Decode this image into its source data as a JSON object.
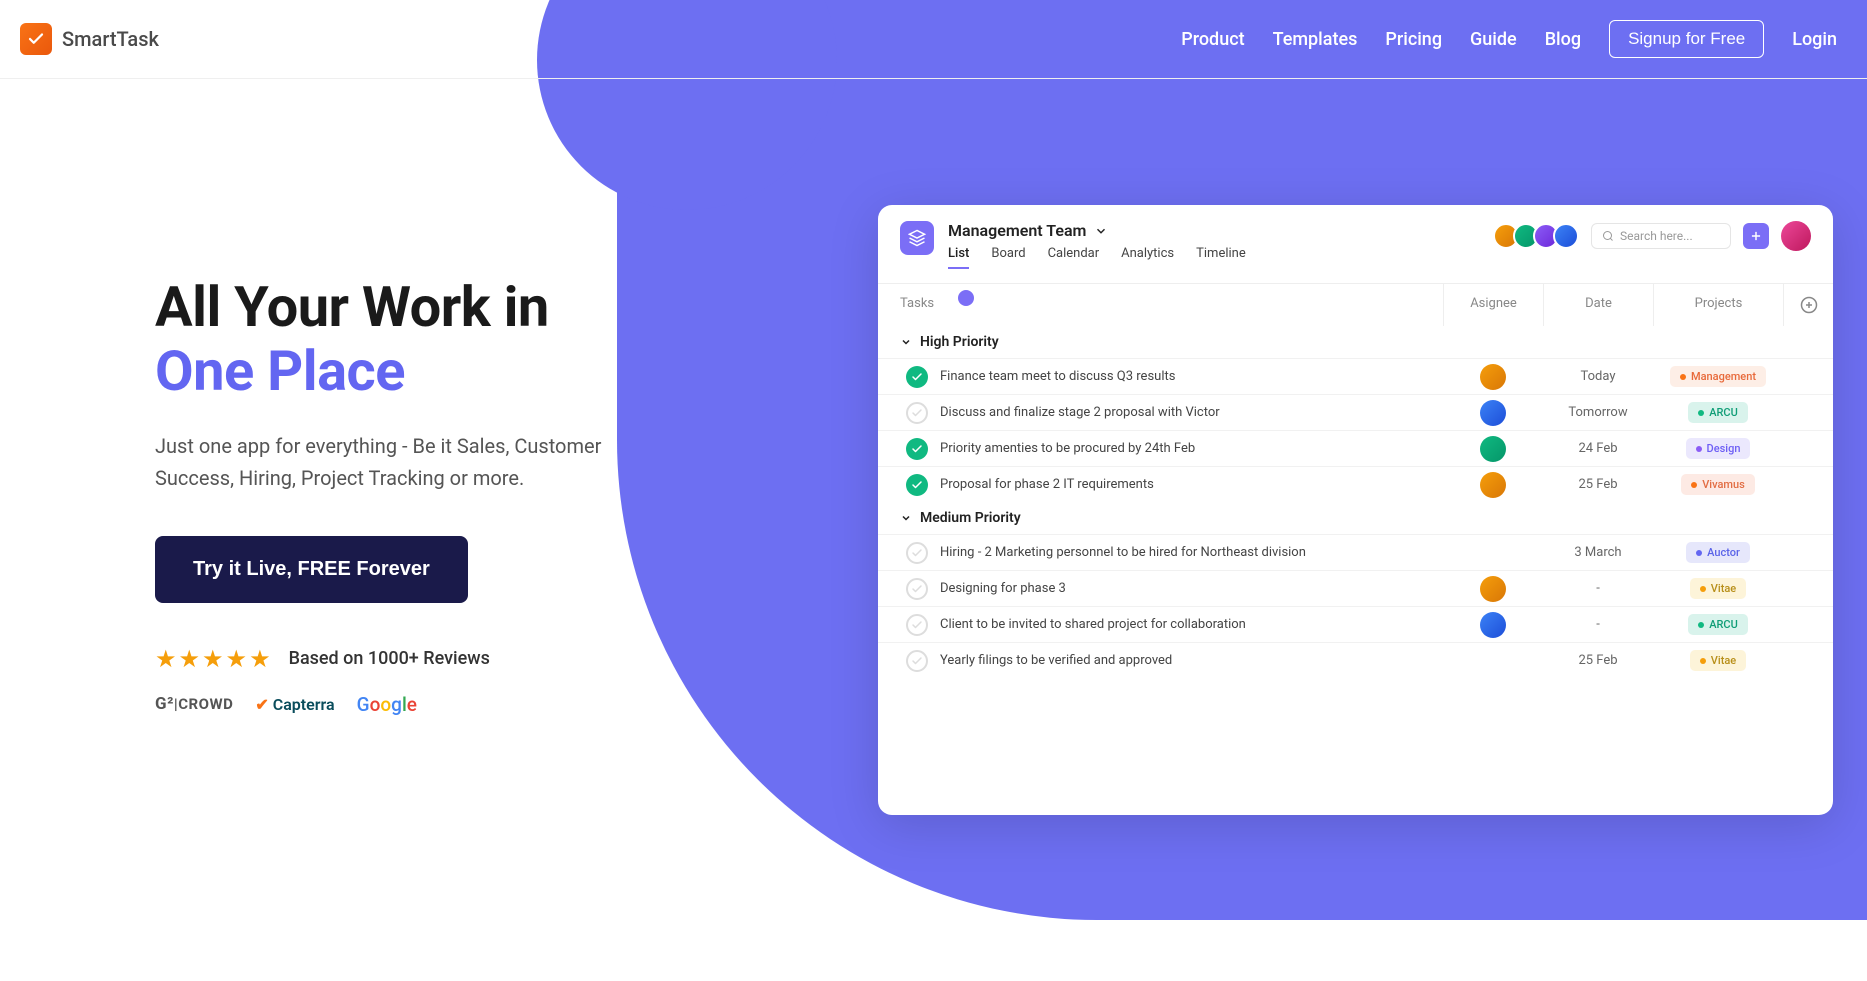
{
  "brand": "SmartTask",
  "nav": {
    "product": "Product",
    "templates": "Templates",
    "pricing": "Pricing",
    "guide": "Guide",
    "blog": "Blog",
    "signup": "Signup for Free",
    "login": "Login"
  },
  "hero": {
    "title_line1": "All Your Work in",
    "title_line2": "One Place",
    "subtitle": "Just one app for everything - Be it Sales, Customer Success, Hiring, Project Tracking or more.",
    "cta": "Try it Live, FREE Forever",
    "rating_text": "Based on 1000+ Reviews",
    "logos": {
      "g2": "G | CROWD",
      "capterra": "Capterra",
      "google": "Google"
    }
  },
  "app": {
    "team_name": "Management Team",
    "tabs": {
      "list": "List",
      "board": "Board",
      "calendar": "Calendar",
      "analytics": "Analytics",
      "timeline": "Timeline"
    },
    "search_placeholder": "Search here...",
    "columns": {
      "tasks": "Tasks",
      "assignee": "Asignee",
      "date": "Date",
      "projects": "Projects"
    },
    "sections": {
      "high": "High Priority",
      "medium": "Medium Priority"
    },
    "tasks_high": [
      {
        "title": "Finance team meet to discuss Q3 results",
        "done": true,
        "assignee": "av1",
        "date": "Today",
        "project": "Management",
        "pill_bg": "#fdeee6",
        "pill_fg": "#e8693a",
        "dot": "#f97316"
      },
      {
        "title": "Discuss and finalize stage 2 proposal with Victor",
        "done": false,
        "assignee": "av4",
        "date": "Tomorrow",
        "project": "ARCU",
        "pill_bg": "#d9f3ec",
        "pill_fg": "#0f9d76",
        "dot": "#10b981"
      },
      {
        "title": "Priority amenties to be procured by 24th Feb",
        "done": true,
        "assignee": "av2",
        "date": "24 Feb",
        "project": "Design",
        "pill_bg": "#ebe8fd",
        "pill_fg": "#6d5ef5",
        "dot": "#8b5cf6"
      },
      {
        "title": "Proposal for phase 2 IT requirements",
        "done": true,
        "assignee": "av1",
        "date": "25 Feb",
        "project": "Vivamus",
        "pill_bg": "#fdeae4",
        "pill_fg": "#e26d43",
        "dot": "#f97316"
      }
    ],
    "tasks_medium": [
      {
        "title": "Hiring - 2 Marketing personnel to be hired for Northeast division",
        "done": false,
        "assignee": "",
        "date": "3 March",
        "project": "Auctor",
        "pill_bg": "#e6e7fb",
        "pill_fg": "#5a63e8",
        "dot": "#6366f1"
      },
      {
        "title": "Designing for phase 3",
        "done": false,
        "assignee": "av1",
        "date": "-",
        "project": "Vitae",
        "pill_bg": "#fdf4d9",
        "pill_fg": "#b88f1a",
        "dot": "#f59e0b"
      },
      {
        "title": "Client to be invited to shared project for collaboration",
        "done": false,
        "assignee": "av4",
        "date": "-",
        "project": "ARCU",
        "pill_bg": "#d9f3ec",
        "pill_fg": "#0f9d76",
        "dot": "#10b981"
      },
      {
        "title": "Yearly filings to be verified and approved",
        "done": false,
        "assignee": "",
        "date": "25 Feb",
        "project": "Vitae",
        "pill_bg": "#fdf4d9",
        "pill_fg": "#b88f1a",
        "dot": "#f59e0b"
      }
    ]
  }
}
